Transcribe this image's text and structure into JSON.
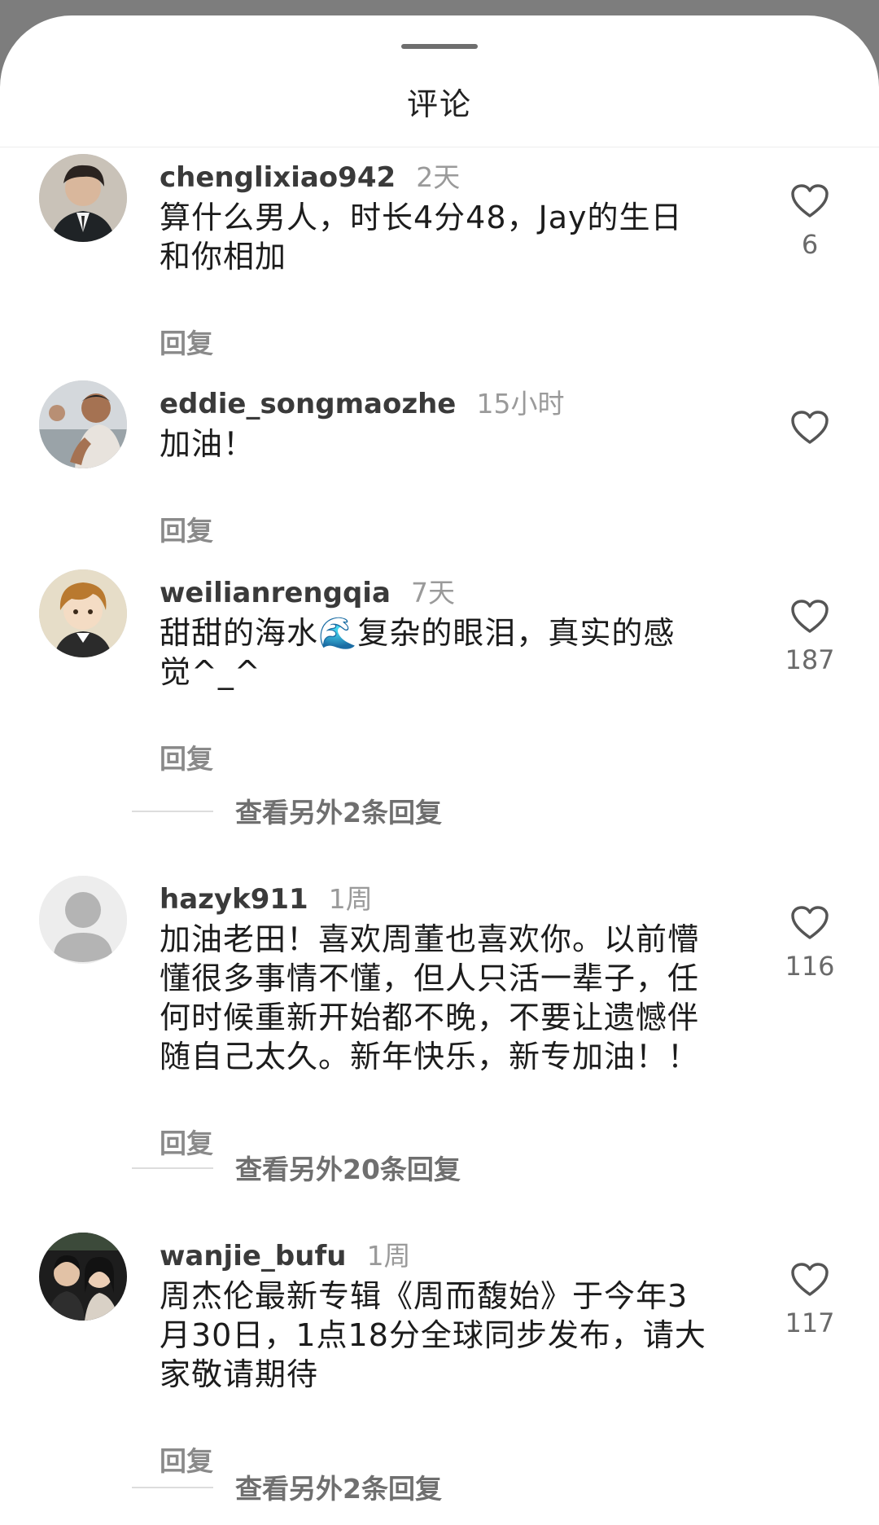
{
  "sheet": {
    "title": "评论"
  },
  "comments": [
    {
      "username": "chenglixiao942",
      "time": "2天",
      "text_lines": [
        "算什么男人，时长4分48，Jay的生日",
        "和你相加"
      ],
      "reply_label": "回复",
      "likes": "6",
      "avatar": "portrait-man-suit"
    },
    {
      "username": "eddie_songmaozhe",
      "time": "15小时",
      "text_lines": [
        "加油！"
      ],
      "reply_label": "回复",
      "likes": "",
      "avatar": "photo-man-gym"
    },
    {
      "username": "weilianrengqia",
      "time": "7天",
      "text_lines": [
        "甜甜的海水🌊复杂的眼泪，真实的感",
        "觉^_^"
      ],
      "reply_label": "回复",
      "likes": "187",
      "avatar": "anime-boy"
    },
    {
      "username": "hazyk911",
      "time": "1周",
      "text_lines": [
        "加油老田！喜欢周董也喜欢你。以前懵",
        "懂很多事情不懂，但人只活一辈子，任",
        "何时候重新开始都不晚，不要让遗憾伴",
        "随自己太久。新年快乐，新专加油！！"
      ],
      "reply_label": "回复",
      "likes": "116",
      "avatar": "default-user"
    },
    {
      "username": "wanjie_bufu",
      "time": "1周",
      "text_lines": [
        "周杰伦最新专辑《周而馥始》于今年3",
        "月30日，1点18分全球同步发布，请大",
        "家敬请期待"
      ],
      "reply_label": "回复",
      "likes": "117",
      "avatar": "couple-photo"
    }
  ],
  "more_replies": [
    "查看另外2条回复",
    "查看另外20条回复",
    "查看另外2条回复"
  ],
  "colors": {
    "backdrop": "#7d7d7d",
    "sheet": "#ffffff",
    "text": "#1c1c1c",
    "muted": "#9a9a9a"
  }
}
